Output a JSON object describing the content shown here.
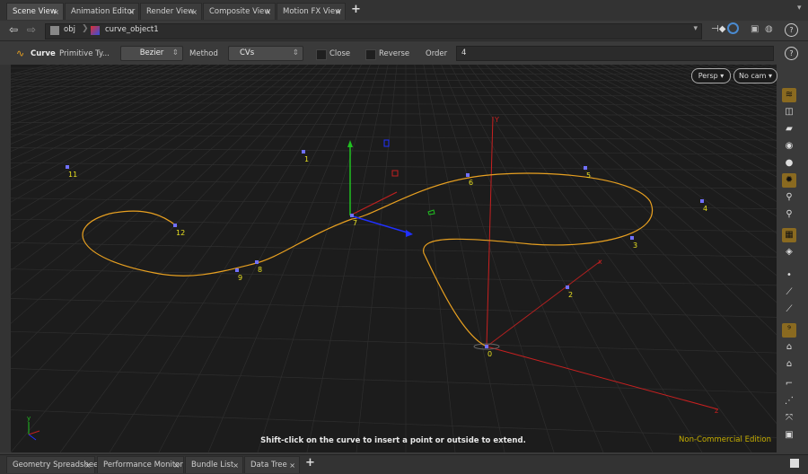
{
  "tabs": [
    {
      "label": "Scene View",
      "active": true
    },
    {
      "label": "Animation Editor"
    },
    {
      "label": "Render View"
    },
    {
      "label": "Composite View"
    },
    {
      "label": "Motion FX View"
    }
  ],
  "bottom_tabs": [
    {
      "label": "Geometry Spreadsheet"
    },
    {
      "label": "Performance Monitor"
    },
    {
      "label": "Bundle List"
    },
    {
      "label": "Data Tree"
    }
  ],
  "path": {
    "segments": [
      "obj",
      "curve_object1"
    ]
  },
  "toolbar": {
    "tool_name": "Curve",
    "primitive_type_label": "Primitive Ty...",
    "primitive_type_value": "Bezier",
    "method_label": "Method",
    "method_value": "CVs",
    "close_label": "Close",
    "reverse_label": "Reverse",
    "order_label": "Order",
    "order_value": "4"
  },
  "viewport": {
    "persp_label": "Persp ▾",
    "cam_label": "No cam ▾",
    "hint": "Shift-click on the curve to insert a point or outside to extend.",
    "edition": "Non-Commercial Edition",
    "axis_y": "Y",
    "axis_origin": "y",
    "axis_x": "x",
    "points": [
      {
        "label": "0"
      },
      {
        "label": "1"
      },
      {
        "label": "2"
      },
      {
        "label": "3"
      },
      {
        "label": "4"
      },
      {
        "label": "5"
      },
      {
        "label": "6"
      },
      {
        "label": "7"
      },
      {
        "label": "8"
      },
      {
        "label": "9"
      },
      {
        "label": "11"
      },
      {
        "label": "12"
      }
    ]
  },
  "colors": {
    "curve": "#e8a020",
    "point": "#7070ff",
    "point_label": "#e8e020",
    "axis_x": "#cc2020",
    "axis_y": "#cc2020",
    "handle_x": "#2030ff",
    "handle_y": "#20cc20",
    "handle_z": "#cc2020",
    "edition": "#c8b000",
    "active_tool": "#8a6a20"
  },
  "icons": [
    "back-arrow-icon",
    "forward-arrow-icon",
    "obj-network-icon",
    "curve-object-icon",
    "pin-icon",
    "link-icon",
    "snap-icon",
    "camera-icon",
    "help-icon",
    "curve-tool-icon",
    "gear-icon"
  ]
}
